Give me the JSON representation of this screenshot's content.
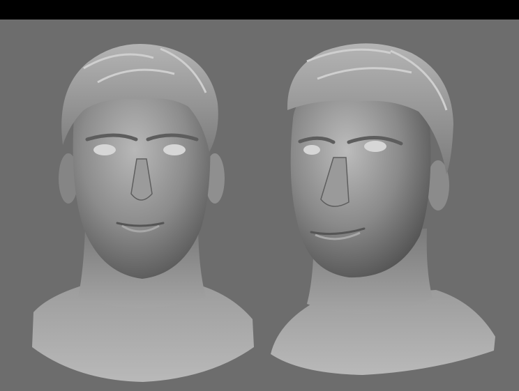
{
  "image": {
    "description_free": true,
    "content": "two-sculpted-head-renders",
    "views": [
      {
        "id": "front",
        "orientation": "front"
      },
      {
        "id": "three-quarter",
        "orientation": "three-quarter-left"
      }
    ]
  },
  "colors": {
    "header_bar": "#000000",
    "background": "#6d6d6d",
    "skin_base": "#8a8a8a",
    "skin_highlight": "#c4c4c4",
    "skin_shadow": "#4a4a4a",
    "hair_base": "#9a9a9a",
    "eye_highlight": "#e6e6e6"
  }
}
